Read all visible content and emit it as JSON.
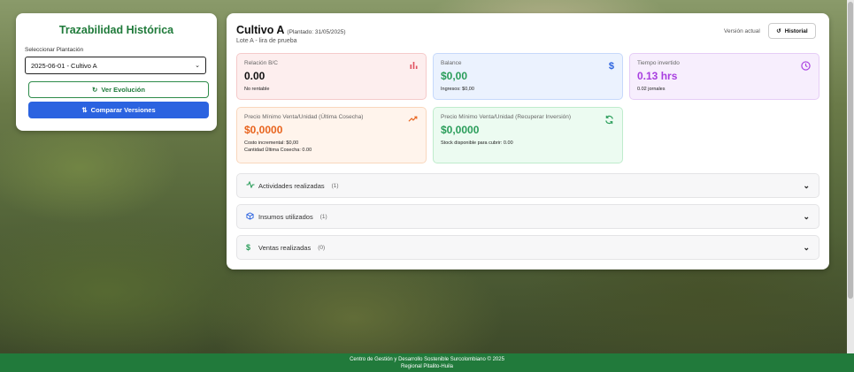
{
  "sidebar": {
    "title": "Trazabilidad Histórica",
    "select_label": "Seleccionar Plantación",
    "select_value": "2025-06-01 - Cultivo A",
    "evolution_button": "Ver Evolución",
    "compare_button": "Comparar Versiones"
  },
  "header": {
    "crop_name": "Cultivo A",
    "planted": "(Plantado: 31/05/2025)",
    "subtitle": "Lote A - lira de prueba",
    "version_label": "Versión actual",
    "history_button": "Historial"
  },
  "stats": {
    "bc": {
      "label": "Relación B/C",
      "value": "0.00",
      "note": "No rentable",
      "color": "#e05260"
    },
    "balance": {
      "label": "Balance",
      "value": "$0,00",
      "note": "Ingresos: $0,00",
      "color": "#2a9d5a"
    },
    "time": {
      "label": "Tiempo invertido",
      "value": "0.13 hrs",
      "note": "0.02 jornales",
      "color": "#a83ee0"
    },
    "min_price_last": {
      "label": "Precio Mínimo Venta/Unidad (Última Cosecha)",
      "value": "$0,0000",
      "note1": "Costo incremental: $0,00",
      "note2": "Cantidad Última Cosecha: 0.00",
      "color": "#e8641e"
    },
    "min_price_recover": {
      "label": "Precio Mínimo Venta/Unidad (Recuperar Inversión)",
      "value": "$0,0000",
      "note": "Stock disponible para cubrir: 0.00",
      "color": "#2a9d5a"
    }
  },
  "accordions": [
    {
      "label": "Actividades realizadas",
      "count": "(1)",
      "icon": "activity-icon"
    },
    {
      "label": "Insumos utilizados",
      "count": "(1)",
      "icon": "box-icon"
    },
    {
      "label": "Ventas realizadas",
      "count": "(0)",
      "icon": "dollar-icon"
    }
  ],
  "footer": {
    "line1": "Centro de Gestión y Desarrollo Sostenible Surcolombiano © 2025",
    "line2": "Regional Pitalito-Huila"
  }
}
